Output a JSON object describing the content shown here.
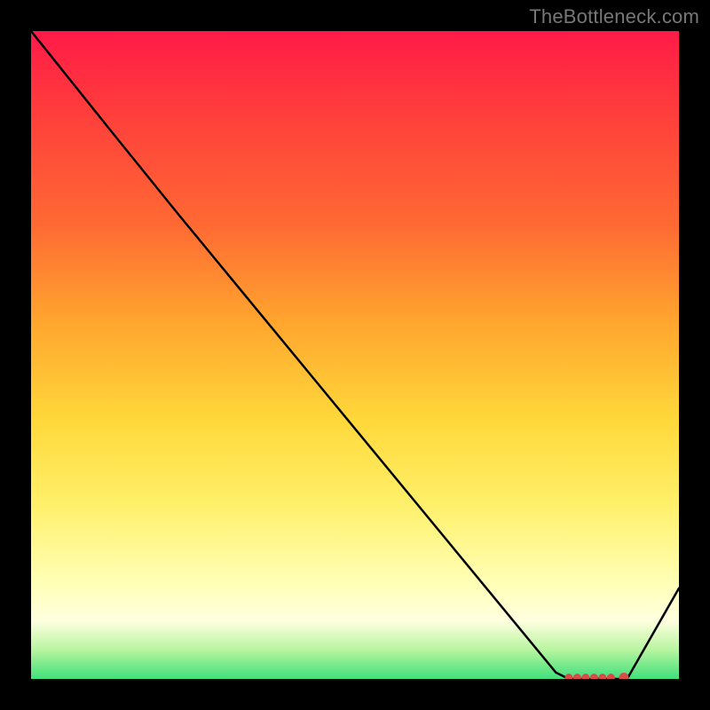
{
  "attribution": "TheBottleneck.com",
  "chart_data": {
    "type": "line",
    "title": "",
    "xlabel": "",
    "ylabel": "",
    "xlim": [
      0,
      100
    ],
    "ylim": [
      0,
      100
    ],
    "series": [
      {
        "name": "curve",
        "x": [
          0,
          12,
          22.5,
          81,
          83,
          86,
          89,
          92,
          100
        ],
        "y": [
          100,
          85,
          72,
          1,
          0,
          0,
          0,
          0,
          14
        ]
      }
    ],
    "markers": {
      "name": "bottom-dots",
      "x": [
        83.0,
        84.3,
        85.6,
        86.9,
        88.2,
        89.5,
        91.5
      ],
      "y": [
        0.2,
        0.2,
        0.2,
        0.2,
        0.2,
        0.2,
        0.2
      ]
    }
  },
  "colors": {
    "curve": "#000000",
    "marker": "#d94a4a"
  }
}
